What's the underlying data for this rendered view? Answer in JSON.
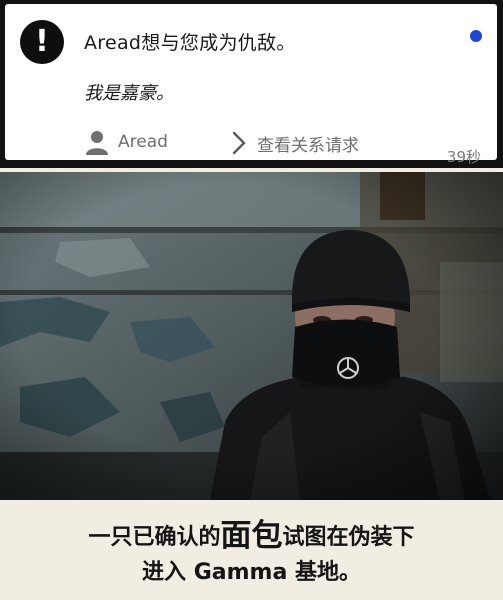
{
  "notification": {
    "headline": "Aread想与您成为仇敌。",
    "message": "我是嘉豪。",
    "user_action": "Aread",
    "view_action": "查看关系请求",
    "time": "39秒",
    "dot_color": "#1c46d6",
    "icon": "alert-icon"
  },
  "photo": {
    "description_icon": "masked-person-photo"
  },
  "caption": {
    "line1_before": "一只已确认的",
    "line1_big": "面包",
    "line1_after": "试图在伪装下",
    "line2": "进入 Gamma 基地。"
  }
}
